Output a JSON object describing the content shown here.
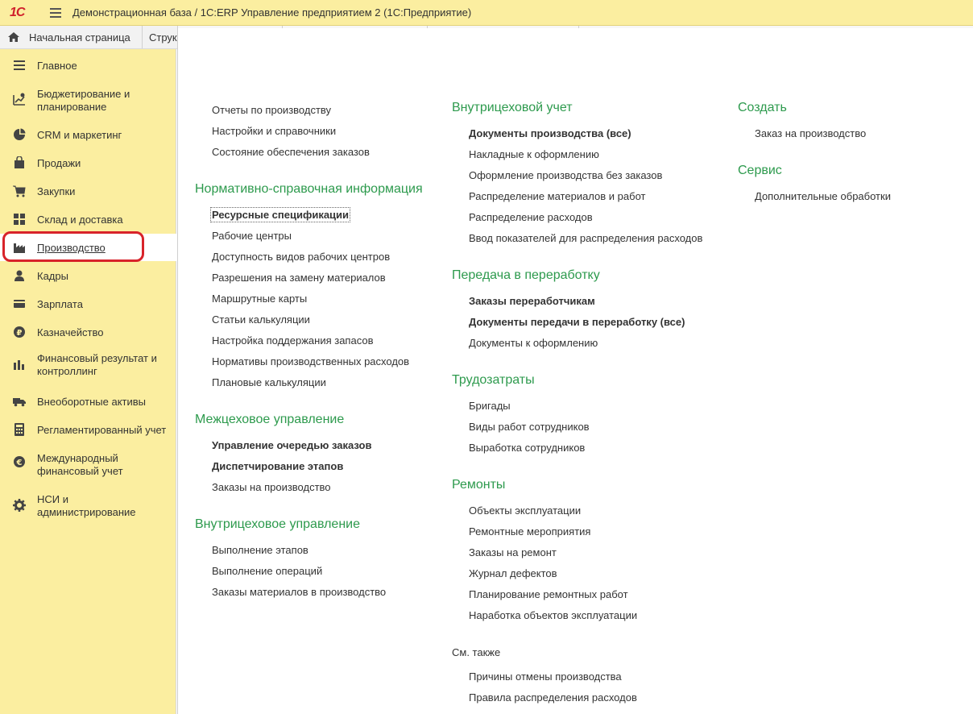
{
  "app": {
    "logo_text": "1С",
    "title": "Демонстрационная база / 1С:ERP Управление предприятием 2  (1С:Предприятие)"
  },
  "tabs": {
    "home": "Начальная страница",
    "second": "Структура предприятия"
  },
  "sidebar": {
    "items": [
      {
        "label": "Главное",
        "icon": "menu-lines-icon"
      },
      {
        "label": "Бюджетирование и планирование",
        "icon": "budget-chart-icon"
      },
      {
        "label": "CRM и маркетинг",
        "icon": "pie-chart-icon"
      },
      {
        "label": "Продажи",
        "icon": "shopping-bag-icon"
      },
      {
        "label": "Закупки",
        "icon": "cart-icon"
      },
      {
        "label": "Склад и доставка",
        "icon": "grid-icon"
      },
      {
        "label": "Производство",
        "icon": "factory-icon",
        "active": true
      },
      {
        "label": "Кадры",
        "icon": "person-icon"
      },
      {
        "label": "Зарплата",
        "icon": "wallet-icon"
      },
      {
        "label": "Казначейство",
        "icon": "ruble-coin-icon"
      },
      {
        "label": "Финансовый результат и контроллинг",
        "icon": "bar-chart-icon"
      },
      {
        "label": "Внеоборотные активы",
        "icon": "truck-icon"
      },
      {
        "label": "Регламентированный учет",
        "icon": "calculator-icon"
      },
      {
        "label": "Международный финансовый учет",
        "icon": "euro-coin-icon"
      },
      {
        "label": "НСИ и администрирование",
        "icon": "gear-icon"
      }
    ]
  },
  "col1": {
    "top_links": [
      "Отчеты по производству",
      "Настройки и справочники",
      "Состояние обеспечения заказов"
    ],
    "nsi": {
      "title": "Нормативно-справочная информация",
      "links": [
        "Ресурсные спецификации",
        "Рабочие центры",
        "Доступность видов рабочих центров",
        "Разрешения на замену материалов",
        "Маршрутные карты",
        "Статьи калькуляции",
        "Настройка поддержания запасов",
        "Нормативы производственных расходов",
        "Плановые калькуляции"
      ]
    },
    "mezh": {
      "title": "Межцеховое управление",
      "links": [
        "Управление очередью заказов",
        "Диспетчирование этапов",
        "Заказы на производство"
      ]
    },
    "vnutr": {
      "title": "Внутрицеховое управление",
      "links": [
        "Выполнение этапов",
        "Выполнение операций",
        "Заказы материалов в производство"
      ]
    }
  },
  "col2": {
    "uchet": {
      "title": "Внутрицеховой учет",
      "links": [
        "Документы производства (все)",
        "Накладные к оформлению",
        "Оформление производства без заказов",
        "Распределение материалов и работ",
        "Распределение расходов",
        "Ввод показателей для распределения расходов"
      ]
    },
    "pererab": {
      "title": "Передача в переработку",
      "links": [
        "Заказы переработчикам",
        "Документы передачи в переработку (все)",
        "Документы к оформлению"
      ]
    },
    "trud": {
      "title": "Трудозатраты",
      "links": [
        "Бригады",
        "Виды работ сотрудников",
        "Выработка сотрудников"
      ]
    },
    "remont": {
      "title": "Ремонты",
      "links": [
        "Объекты эксплуатации",
        "Ремонтные мероприятия",
        "Заказы на ремонт",
        "Журнал дефектов",
        "Планирование ремонтных работ",
        "Наработка объектов эксплуатации"
      ]
    },
    "see_also": {
      "title": "См. также",
      "links": [
        "Причины отмены производства",
        "Правила распределения расходов"
      ]
    }
  },
  "col3": {
    "create": {
      "title": "Создать",
      "links": [
        "Заказ на производство"
      ]
    },
    "service": {
      "title": "Сервис",
      "links": [
        "Дополнительные обработки"
      ]
    }
  },
  "colors": {
    "accent_yellow": "#fbeea0",
    "group_green": "#2d9a4d",
    "highlight_red": "#d8232a"
  }
}
